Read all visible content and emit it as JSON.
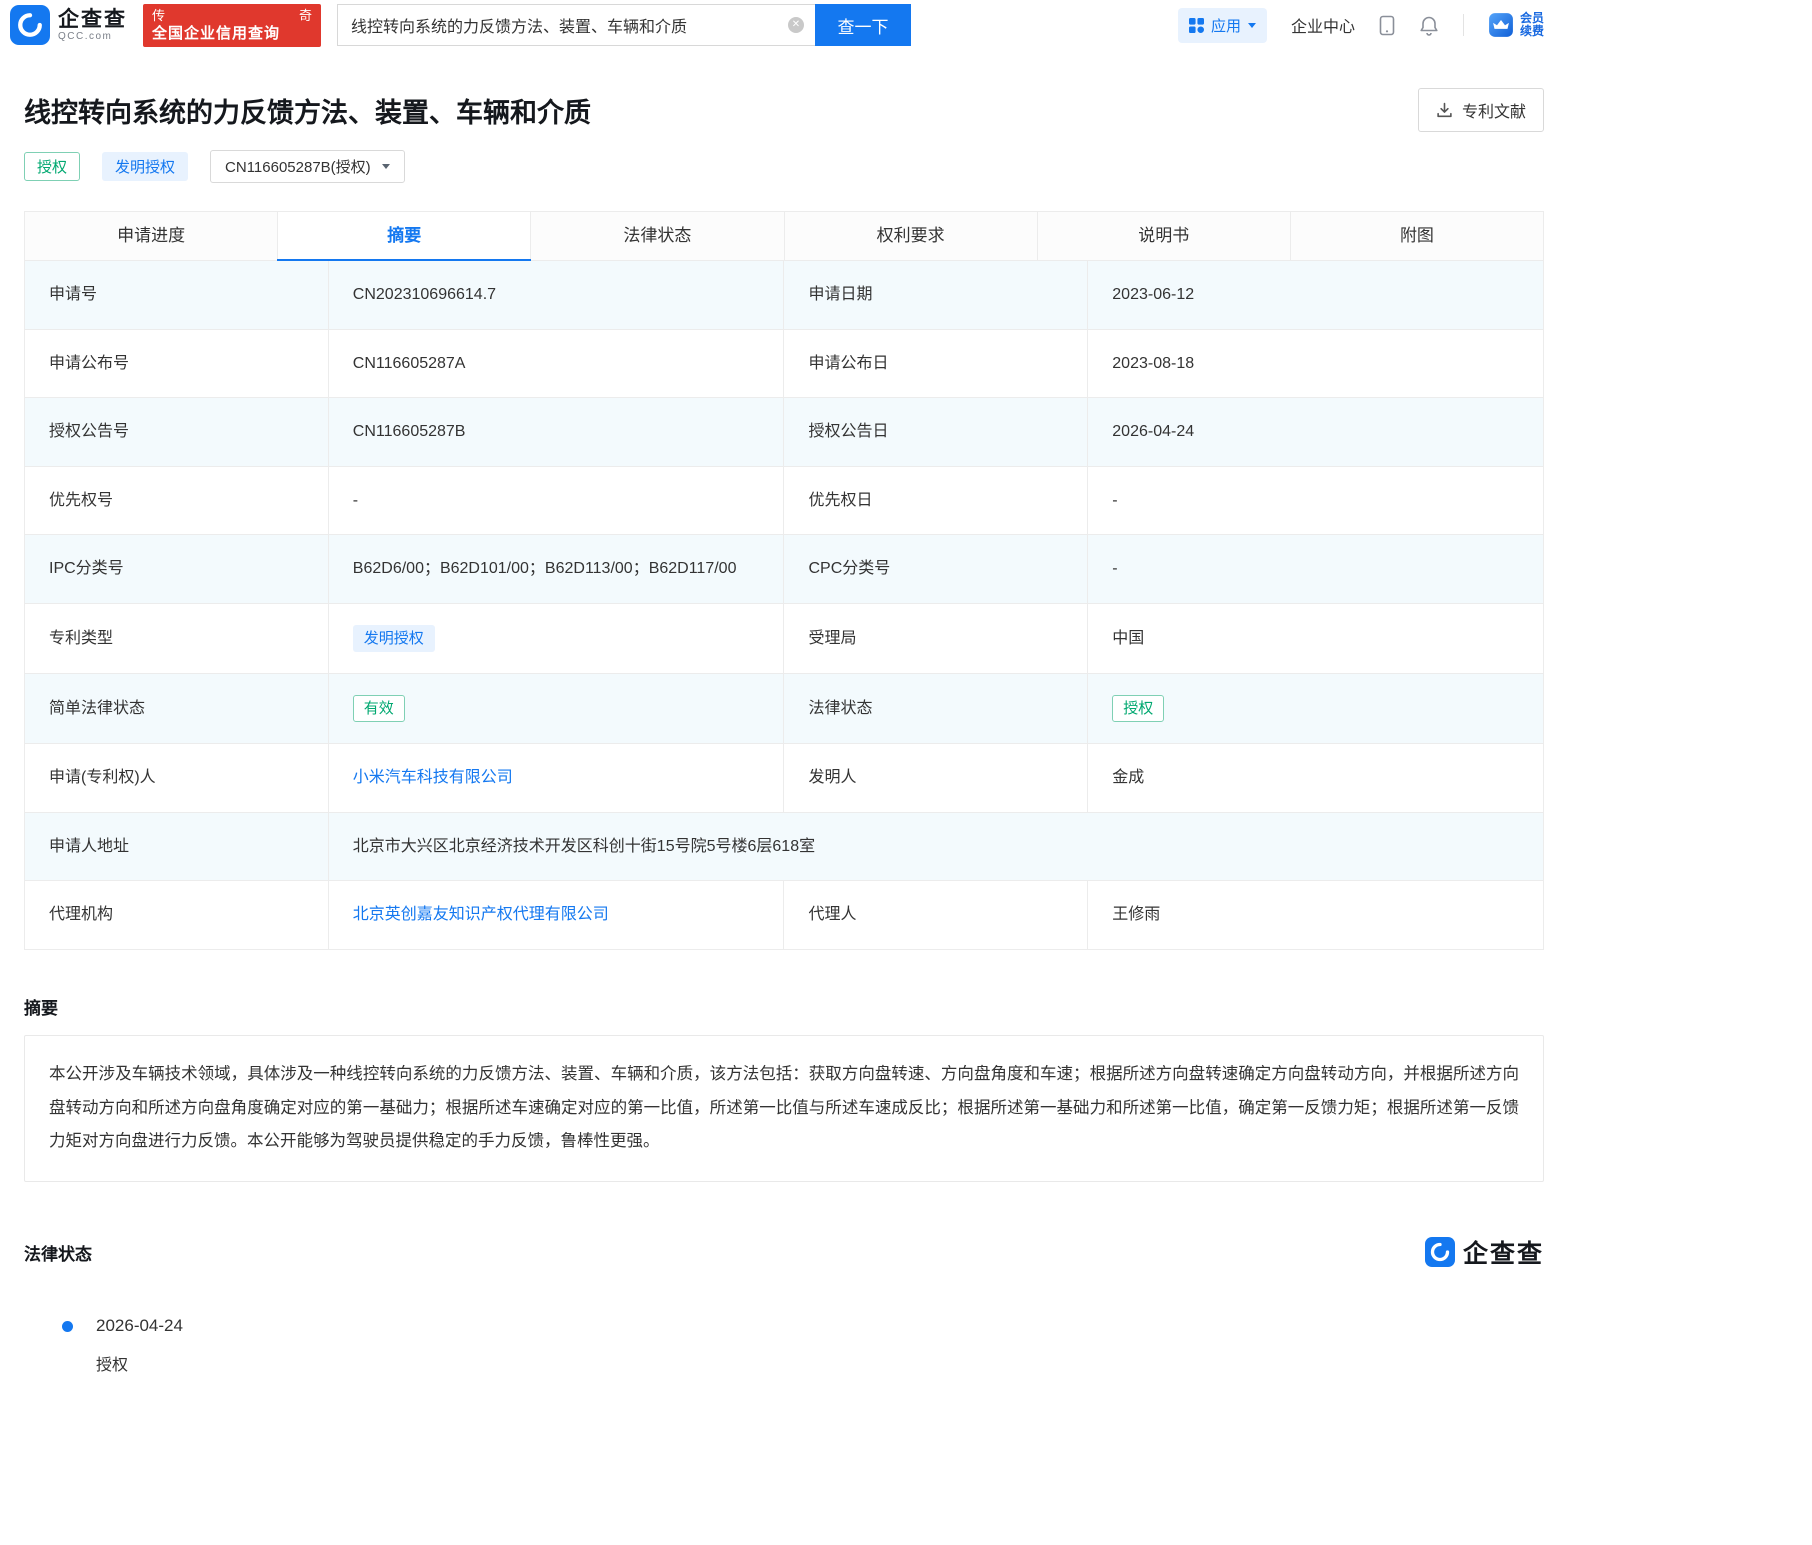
{
  "header": {
    "logo": {
      "name": "企查查",
      "domain": "QCC.com"
    },
    "promo": {
      "left": "传",
      "right": "奇",
      "line2": "全国企业信用查询"
    },
    "search": {
      "value": "线控转向系统的力反馈方法、装置、车辆和介质",
      "button": "查一下"
    },
    "nav": {
      "apps": "应用",
      "enterprise_center": "企业中心"
    },
    "member": {
      "line1": "会员",
      "line2": "续费"
    }
  },
  "patent": {
    "title": "线控转向系统的力反馈方法、装置、车辆和介质",
    "download_button": "专利文献",
    "grant_badge": "授权",
    "type_badge": "发明授权",
    "number_select": "CN116605287B(授权)"
  },
  "tabs": [
    {
      "name": "tab-application-progress",
      "label": "申请进度",
      "active": false
    },
    {
      "name": "tab-abstract",
      "label": "摘要",
      "active": true
    },
    {
      "name": "tab-legal-status",
      "label": "法律状态",
      "active": false
    },
    {
      "name": "tab-claims",
      "label": "权利要求",
      "active": false
    },
    {
      "name": "tab-description",
      "label": "说明书",
      "active": false
    },
    {
      "name": "tab-drawings",
      "label": "附图",
      "active": false
    }
  ],
  "info_table": {
    "rows": [
      {
        "cells": [
          {
            "type": "label",
            "text": "申请号"
          },
          {
            "type": "text",
            "text": "CN202310696614.7"
          },
          {
            "type": "label",
            "text": "申请日期"
          },
          {
            "type": "text",
            "text": "2023-06-12"
          }
        ]
      },
      {
        "cells": [
          {
            "type": "label",
            "text": "申请公布号"
          },
          {
            "type": "text",
            "text": "CN116605287A"
          },
          {
            "type": "label",
            "text": "申请公布日"
          },
          {
            "type": "text",
            "text": "2023-08-18"
          }
        ]
      },
      {
        "cells": [
          {
            "type": "label",
            "text": "授权公告号"
          },
          {
            "type": "text",
            "text": "CN116605287B"
          },
          {
            "type": "label",
            "text": "授权公告日"
          },
          {
            "type": "text",
            "text": "2026-04-24"
          }
        ]
      },
      {
        "cells": [
          {
            "type": "label",
            "text": "优先权号"
          },
          {
            "type": "text",
            "text": "-"
          },
          {
            "type": "label",
            "text": "优先权日"
          },
          {
            "type": "text",
            "text": "-"
          }
        ]
      },
      {
        "cells": [
          {
            "type": "label",
            "text": "IPC分类号"
          },
          {
            "type": "text",
            "text": "B62D6/00；B62D101/00；B62D113/00；B62D117/00"
          },
          {
            "type": "label",
            "text": "CPC分类号"
          },
          {
            "type": "text",
            "text": "-"
          }
        ]
      },
      {
        "cells": [
          {
            "type": "label",
            "text": "专利类型"
          },
          {
            "type": "badge-blue",
            "name": "patent-type-badge",
            "text": "发明授权"
          },
          {
            "type": "label",
            "text": "受理局"
          },
          {
            "type": "text",
            "text": "中国"
          }
        ]
      },
      {
        "cells": [
          {
            "type": "label",
            "text": "简单法律状态"
          },
          {
            "type": "badge-green",
            "name": "simple-legal-status-badge",
            "text": "有效"
          },
          {
            "type": "label",
            "text": "法律状态"
          },
          {
            "type": "badge-green",
            "name": "legal-status-badge",
            "text": "授权"
          }
        ]
      },
      {
        "cells": [
          {
            "type": "label",
            "text": "申请(专利权)人"
          },
          {
            "type": "link",
            "name": "applicant-link",
            "text": "小米汽车科技有限公司"
          },
          {
            "type": "label",
            "text": "发明人"
          },
          {
            "type": "text",
            "text": "金成"
          }
        ]
      },
      {
        "cells": [
          {
            "type": "label",
            "text": "申请人地址"
          },
          {
            "type": "text",
            "span": 3,
            "text": "北京市大兴区北京经济技术开发区科创十街15号院5号楼6层618室"
          }
        ]
      },
      {
        "cells": [
          {
            "type": "label",
            "text": "代理机构"
          },
          {
            "type": "link",
            "name": "agency-link",
            "text": "北京英创嘉友知识产权代理有限公司"
          },
          {
            "type": "label",
            "text": "代理人"
          },
          {
            "type": "text",
            "text": "王修雨"
          }
        ]
      }
    ]
  },
  "abstract": {
    "heading": "摘要",
    "text": "本公开涉及车辆技术领域，具体涉及一种线控转向系统的力反馈方法、装置、车辆和介质，该方法包括：获取方向盘转速、方向盘角度和车速；根据所述方向盘转速确定方向盘转动方向，并根据所述方向盘转动方向和所述方向盘角度确定对应的第一基础力；根据所述车速确定对应的第一比值，所述第一比值与所述车速成反比；根据所述第一基础力和所述第一比值，确定第一反馈力矩；根据所述第一反馈力矩对方向盘进行力反馈。本公开能够为驾驶员提供稳定的手力反馈，鲁棒性更强。"
  },
  "legal": {
    "heading": "法律状态",
    "watermark": "企查查",
    "items": [
      {
        "date": "2026-04-24",
        "status": "授权"
      }
    ]
  },
  "colors": {
    "brand_blue": "#1478f0",
    "green": "#00a870",
    "promo_red": "#e0382d",
    "stripe": "#f3fafd",
    "border": "#ececec"
  }
}
